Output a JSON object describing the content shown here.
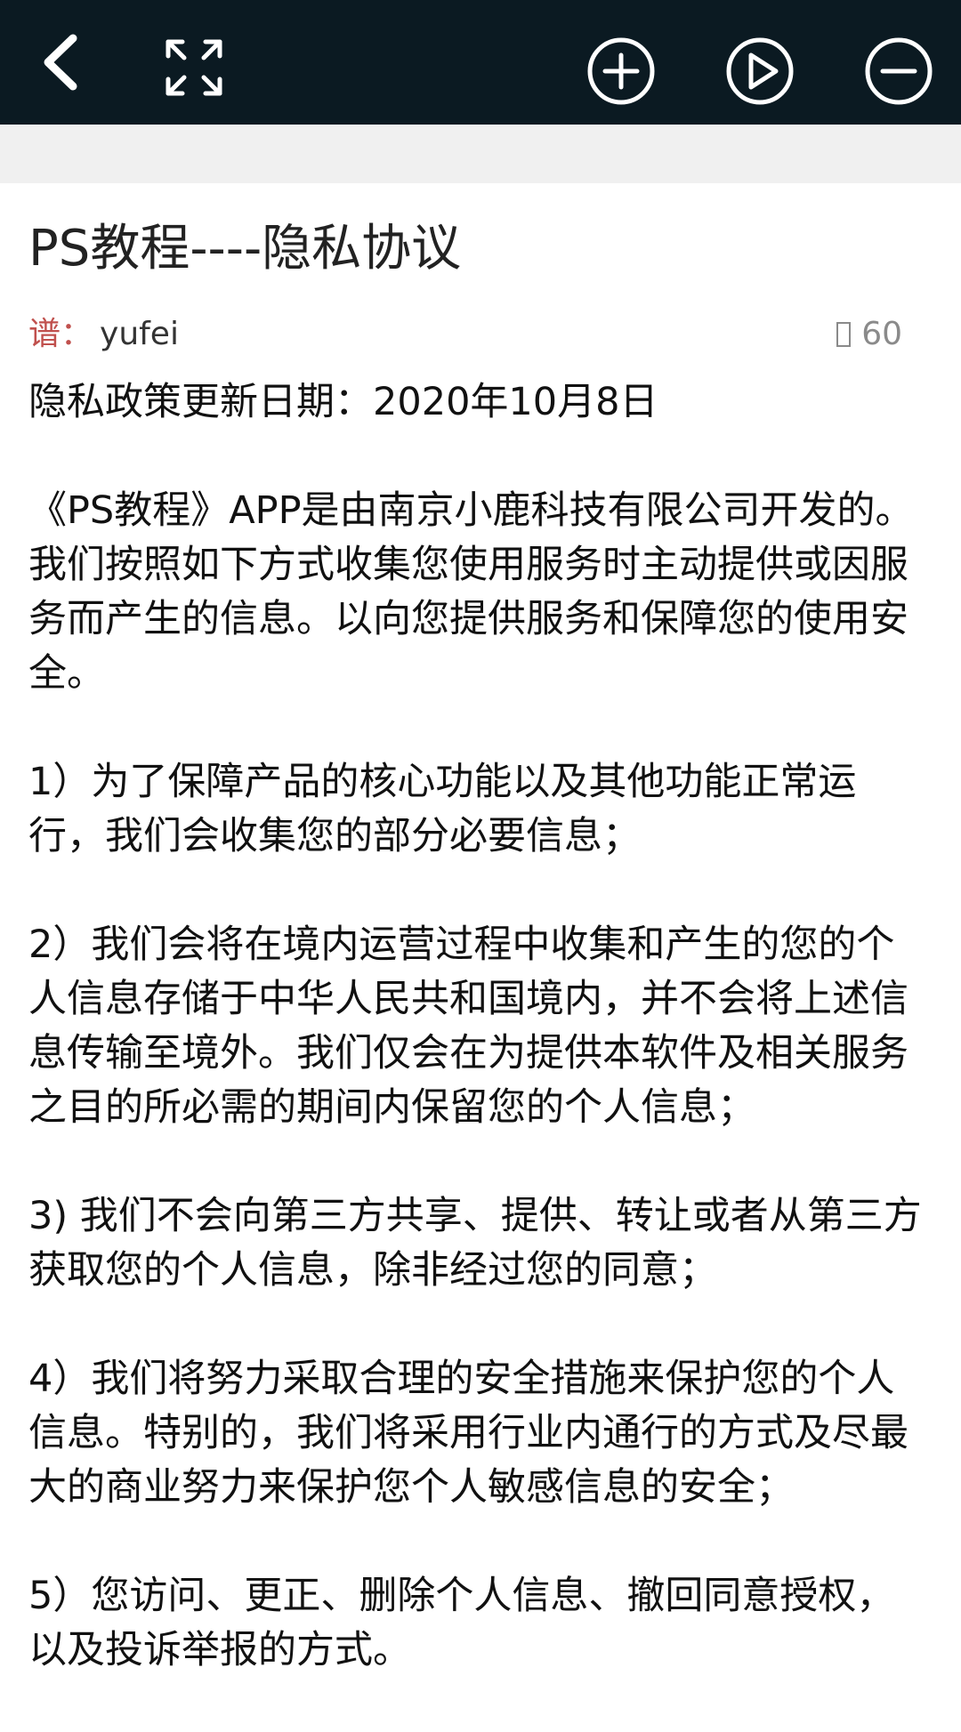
{
  "toolbar": {
    "back": "back-icon",
    "fullscreen": "fullscreen-icon",
    "zoom_in": "zoom-in-icon",
    "play": "play-icon",
    "zoom_out": "zoom-out-icon",
    "background": "#0b1a22"
  },
  "article": {
    "title": "PS教程----隐私协议",
    "author_prefix": "谱：",
    "author": "yufei",
    "views": "60",
    "update_date": "隐私政策更新日期：2020年10月8日",
    "intro": "《PS教程》APP是由南京小鹿科技有限公司开发的。我们按照如下方式收集您使用服务时主动提供或因服务而产生的信息。以向您提供服务和保障您的使用安全。",
    "item1": "1）为了保障产品的核心功能以及其他功能正常运行，我们会收集您的部分必要信息；",
    "item2": "2）我们会将在境内运营过程中收集和产生的您的个人信息存储于中华人民共和国境内，并不会将上述信息传输至境外。我们仅会在为提供本软件及相关服务之目的所必需的期间内保留您的个人信息；",
    "item3": "3) 我们不会向第三方共享、提供、转让或者从第三方获取您的个人信息，除非经过您的同意；",
    "item4": "4）我们将努力采取合理的安全措施来保护您的个人信息。特别的，我们将采用行业内通行的方式及尽最大的商业努力来保护您个人敏感信息的安全；",
    "item5": "5）您访问、更正、删除个人信息、撤回同意授权，以及投诉举报的方式。"
  },
  "colors": {
    "author_prefix": "#c0504d",
    "views": "#8a8a8a"
  }
}
